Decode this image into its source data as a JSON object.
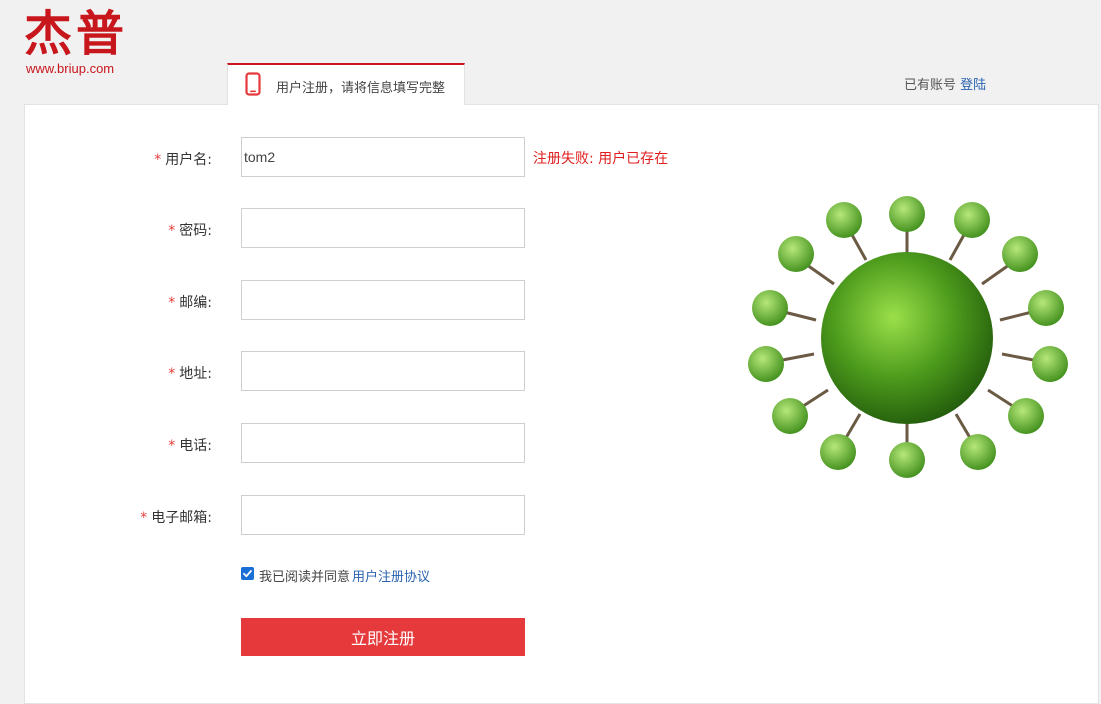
{
  "logo": {
    "title": "杰普",
    "url_text": "www.briup.com"
  },
  "tab": {
    "icon": "mobile-phone-icon",
    "label": "用户注册，请将信息填写完整"
  },
  "login_hint": {
    "text": "已有账号",
    "link_label": "登陆"
  },
  "form": {
    "required_mark": "*",
    "fields": [
      {
        "label": "用户名:",
        "value": "tom2",
        "placeholder": ""
      },
      {
        "label": "密码:",
        "value": "",
        "placeholder": ""
      },
      {
        "label": "邮编:",
        "value": "",
        "placeholder": ""
      },
      {
        "label": "地址:",
        "value": "",
        "placeholder": ""
      },
      {
        "label": "电话:",
        "value": "",
        "placeholder": ""
      },
      {
        "label": "电子邮箱:",
        "value": "",
        "placeholder": ""
      }
    ],
    "error_message": "注册失败: 用户已存在",
    "agreement": {
      "checked": true,
      "text": "我已阅读并同意",
      "link_label": "用户注册协议"
    },
    "submit_label": "立即注册"
  },
  "colors": {
    "brand_red": "#c8161d",
    "button_red": "#e5393c",
    "link_blue": "#2a63b0",
    "error_red": "#e01e1e"
  },
  "image": {
    "icon": "green-globe-trees-illustration"
  }
}
